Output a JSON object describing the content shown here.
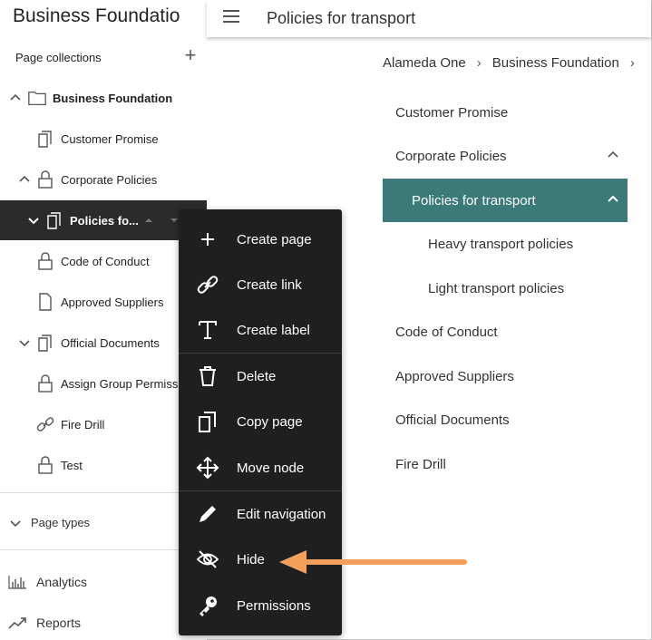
{
  "app": {
    "title": "Business Foundatio"
  },
  "topbar": {
    "title": "Policies for transport"
  },
  "sidebar": {
    "collections_label": "Page collections",
    "add_symbol": "+",
    "tree": [
      {
        "label": "Business Foundation"
      },
      {
        "label": "Customer Promise"
      },
      {
        "label": "Corporate Policies"
      },
      {
        "label": "Policies fo..."
      },
      {
        "label": "Code of Conduct"
      },
      {
        "label": "Approved Suppliers"
      },
      {
        "label": "Official Documents"
      },
      {
        "label": "Assign Group Permiss"
      },
      {
        "label": "Fire Drill"
      },
      {
        "label": "Test"
      }
    ],
    "page_types_label": "Page types",
    "analytics_label": "Analytics",
    "reports_label": "Reports"
  },
  "breadcrumb": {
    "items": [
      "Alameda One",
      "Business Foundation"
    ],
    "separator": "›"
  },
  "nav": {
    "items": [
      {
        "label": "Customer Promise"
      },
      {
        "label": "Corporate Policies"
      },
      {
        "label": "Policies for transport"
      },
      {
        "label": "Heavy transport policies"
      },
      {
        "label": "Light transport policies"
      },
      {
        "label": "Code of Conduct"
      },
      {
        "label": "Approved Suppliers"
      },
      {
        "label": "Official Documents"
      },
      {
        "label": "Fire Drill"
      }
    ]
  },
  "context_menu": {
    "items": [
      {
        "label": "Create page",
        "icon": "plus-icon"
      },
      {
        "label": "Create link",
        "icon": "link-icon"
      },
      {
        "label": "Create label",
        "icon": "text-icon"
      },
      {
        "label": "Delete",
        "icon": "trash-icon"
      },
      {
        "label": "Copy page",
        "icon": "copy-icon"
      },
      {
        "label": "Move node",
        "icon": "move-icon"
      },
      {
        "label": "Edit navigation",
        "icon": "pencil-icon"
      },
      {
        "label": "Hide",
        "icon": "eye-off-icon"
      },
      {
        "label": "Permissions",
        "icon": "key-icon"
      }
    ]
  },
  "colors": {
    "active_nav": "#3b7a79",
    "menu_bg": "#1f1f1f",
    "arrow": "#f5a05a"
  }
}
